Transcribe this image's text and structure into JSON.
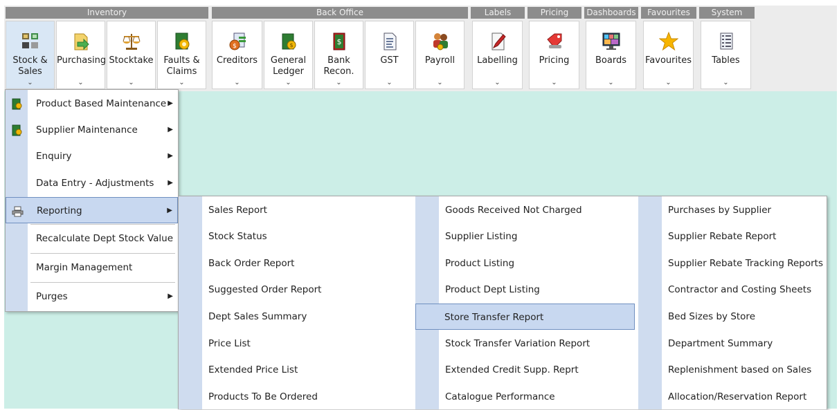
{
  "ribbon": {
    "groups": [
      {
        "name": "Inventory"
      },
      {
        "name": "Back Office"
      },
      {
        "name": "Labels"
      },
      {
        "name": "Pricing"
      },
      {
        "name": "Dashboards"
      },
      {
        "name": "Favourites"
      },
      {
        "name": "System"
      }
    ],
    "buttons": [
      {
        "label": "Stock &\nSales",
        "icon": "stock-sales-icon"
      },
      {
        "label": "Purchasing",
        "icon": "purchasing-icon"
      },
      {
        "label": "Stocktake",
        "icon": "scales-icon"
      },
      {
        "label": "Faults &\nClaims",
        "icon": "faults-claims-icon"
      },
      {
        "label": "Creditors",
        "icon": "creditors-icon"
      },
      {
        "label": "General\nLedger",
        "icon": "ledger-icon"
      },
      {
        "label": "Bank\nRecon.",
        "icon": "bank-book-icon"
      },
      {
        "label": "GST",
        "icon": "document-icon"
      },
      {
        "label": "Payroll",
        "icon": "payroll-icon"
      },
      {
        "label": "Labelling",
        "icon": "pencil-icon"
      },
      {
        "label": "Pricing",
        "icon": "price-tag-icon"
      },
      {
        "label": "Boards",
        "icon": "monitor-board-icon"
      },
      {
        "label": "Favourites",
        "icon": "star-icon"
      },
      {
        "label": "Tables",
        "icon": "table-icon"
      }
    ]
  },
  "menu": {
    "items": [
      {
        "label": "Product Based Maintenance",
        "submenu": true,
        "icon": "book-gear-icon"
      },
      {
        "label": "Supplier Maintenance",
        "submenu": true,
        "icon": "book-gear-icon"
      },
      {
        "label": "Enquiry",
        "submenu": true
      },
      {
        "label": "Data Entry - Adjustments",
        "submenu": true
      },
      {
        "label": "Reporting",
        "submenu": true,
        "icon": "printer-icon",
        "highlighted": true
      },
      {
        "label": "Recalculate Dept Stock Value",
        "submenu": false
      },
      {
        "label": "Margin Management",
        "submenu": false
      },
      {
        "label": "Purges",
        "submenu": true
      }
    ]
  },
  "reporting_submenu": {
    "columns": [
      [
        "Sales Report",
        "Stock Status",
        "Back Order Report",
        "Suggested Order Report",
        "Dept Sales Summary",
        "Price List",
        "Extended Price List",
        "Products To Be Ordered"
      ],
      [
        "Goods Received Not Charged",
        "Supplier Listing",
        "Product Listing",
        "Product Dept Listing",
        "Store Transfer Report",
        "Stock Transfer Variation Report",
        "Extended Credit Supp. Reprt",
        "Catalogue Performance"
      ],
      [
        "Purchases by Supplier",
        "Supplier Rebate Report",
        "Supplier Rebate Tracking Reports",
        "Contractor and Costing Sheets",
        "Bed Sizes by Store",
        "Department Summary",
        "Replenishment based on Sales",
        "Allocation/Reservation Report"
      ]
    ],
    "highlighted": "Store Transfer Report"
  },
  "colors": {
    "workspace": "#cceee7",
    "menu_gutter": "#cfdcef",
    "highlight": "#c8d8f0",
    "group_header": "#8c8c8c"
  }
}
